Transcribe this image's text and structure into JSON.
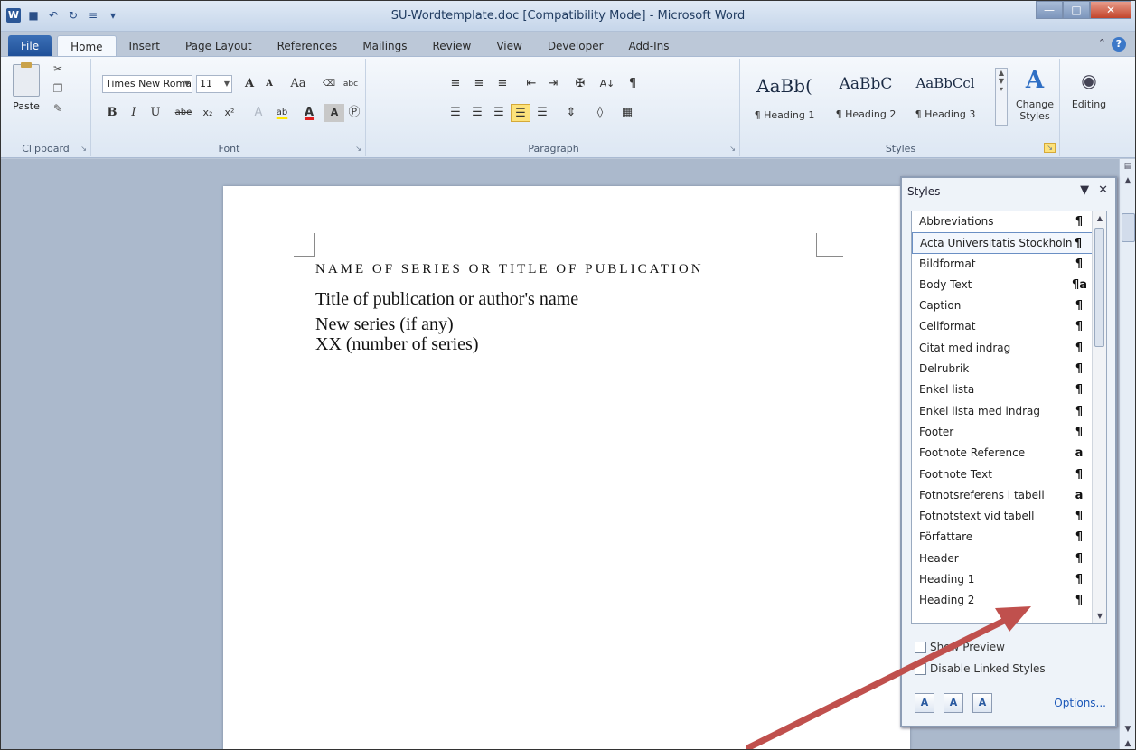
{
  "window": {
    "title": "SU-Wordtemplate.doc [Compatibility Mode] - Microsoft Word",
    "app_icon": "W"
  },
  "ribbon_tabs": [
    "File",
    "Home",
    "Insert",
    "Page Layout",
    "References",
    "Mailings",
    "Review",
    "View",
    "Developer",
    "Add-Ins"
  ],
  "active_tab": "Home",
  "clipboard": {
    "paste_label": "Paste",
    "group_label": "Clipboard"
  },
  "font": {
    "font_name": "Times New Roma",
    "font_size": "11",
    "group_label": "Font",
    "grow_label": "A",
    "shrink_label": "A",
    "case_label": "Aa",
    "bold": "B",
    "italic": "I",
    "underline": "U",
    "strike": "abe",
    "subscript": "x₂",
    "superscript": "x²",
    "highlight": "ab",
    "color": "A",
    "shade": "A",
    "ruby": "abc",
    "border": "A"
  },
  "paragraph": {
    "group_label": "Paragraph",
    "show_marks": "¶",
    "sort": "A↓"
  },
  "styles": {
    "group_label": "Styles",
    "cards": [
      {
        "sample": "AaBb(",
        "name": "¶ Heading 1"
      },
      {
        "sample": "AaBbC",
        "name": "¶ Heading 2"
      },
      {
        "sample": "AaBbCcl",
        "name": "¶ Heading 3"
      }
    ],
    "change_styles_label": "Change Styles",
    "editing_label": "Editing"
  },
  "document": {
    "lines": [
      "NAME OF SERIES OR TITLE OF PUBLICATION",
      "Title of publication or author's name",
      "New series (if any)",
      "XX (number of series)"
    ]
  },
  "styles_pane": {
    "title": "Styles",
    "items": [
      {
        "name": "Abbreviations",
        "mark": "¶"
      },
      {
        "name": "Acta Universitatis Stockholn",
        "mark": "¶"
      },
      {
        "name": "Bildformat",
        "mark": "¶"
      },
      {
        "name": "Body Text",
        "mark": "¶a"
      },
      {
        "name": "Caption",
        "mark": "¶"
      },
      {
        "name": "Cellformat",
        "mark": "¶"
      },
      {
        "name": "Citat med indrag",
        "mark": "¶"
      },
      {
        "name": "Delrubrik",
        "mark": "¶"
      },
      {
        "name": "Enkel lista",
        "mark": "¶"
      },
      {
        "name": "Enkel lista med indrag",
        "mark": "¶"
      },
      {
        "name": "Footer",
        "mark": "¶"
      },
      {
        "name": "Footnote Reference",
        "mark": "a"
      },
      {
        "name": "Footnote Text",
        "mark": "¶"
      },
      {
        "name": "Fotnotsreferens i tabell",
        "mark": "a"
      },
      {
        "name": "Fotnotstext vid tabell",
        "mark": "¶"
      },
      {
        "name": "Författare",
        "mark": "¶"
      },
      {
        "name": "Header",
        "mark": "¶"
      },
      {
        "name": "Heading 1",
        "mark": "¶"
      },
      {
        "name": "Heading 2",
        "mark": "¶"
      }
    ],
    "selected_index": 1,
    "show_preview_label": "Show Preview",
    "disable_linked_label": "Disable Linked Styles",
    "options_label": "Options..."
  },
  "colors": {
    "annotation_arrow": "#c0504d",
    "file_tab": "#2b5797"
  }
}
